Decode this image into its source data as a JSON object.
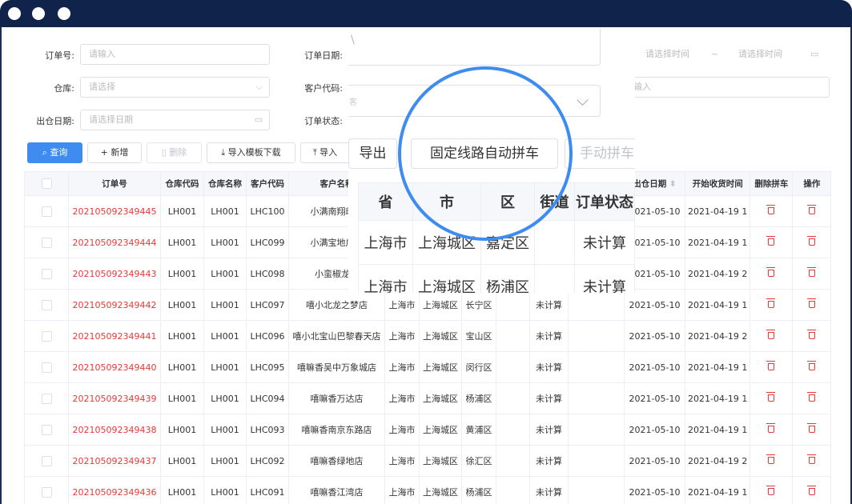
{
  "form": {
    "order_no_label": "订单号:",
    "order_no_placeholder": "请输入",
    "order_date_label": "订单日期:",
    "date_start_placeholder": "请选择时间",
    "date_sep": "~",
    "date_end_placeholder": "请选择时间",
    "warehouse_label": "仓库:",
    "warehouse_placeholder": "请选择",
    "customer_code_label": "客户代码:",
    "customer_code_placeholder": "输入",
    "out_date_label": "出仓日期:",
    "out_date_placeholder": "请选择日期",
    "order_status_label": "订单状态:"
  },
  "toolbar": {
    "query": "查询",
    "add": "新增",
    "delete": "删除",
    "import_template": "导入模板下载",
    "import": "导入"
  },
  "table": {
    "headers": [
      "订单号",
      "仓库代码",
      "仓库名称",
      "客户代码",
      "客户名称",
      "",
      "",
      "",
      "",
      "",
      "",
      "出仓日期",
      "开始收货时间",
      "删除拼车",
      "操作"
    ],
    "rows": [
      {
        "order": "202105092349445",
        "wh_code": "LH001",
        "wh_name": "LH001",
        "cust_code": "LHC100",
        "cust_name": "小满南翔印象",
        "prov": "",
        "city": "",
        "dist": "",
        "street": "",
        "status": "",
        "blank": "",
        "out_date": "2021-05-10",
        "recv": "2021-04-19 1"
      },
      {
        "order": "202105092349444",
        "wh_code": "LH001",
        "wh_name": "LH001",
        "cust_code": "LHC099",
        "cust_name": "小满宝地广场",
        "prov": "",
        "city": "",
        "dist": "",
        "street": "",
        "status": "",
        "blank": "",
        "out_date": "2021-05-10",
        "recv": "2021-04-19 1"
      },
      {
        "order": "202105092349443",
        "wh_code": "LH001",
        "wh_name": "LH001",
        "cust_code": "LHC098",
        "cust_name": "小蛮椒龙华",
        "prov": "",
        "city": "",
        "dist": "",
        "street": "",
        "status": "",
        "blank": "",
        "out_date": "2021-05-10",
        "recv": "2021-04-19 2"
      },
      {
        "order": "202105092349442",
        "wh_code": "LH001",
        "wh_name": "LH001",
        "cust_code": "LHC097",
        "cust_name": "嘻小北龙之梦店",
        "prov": "上海市",
        "city": "上海城区",
        "dist": "长宁区",
        "street": "",
        "status": "未计算",
        "blank": "",
        "out_date": "2021-05-10",
        "recv": "2021-04-19 1"
      },
      {
        "order": "202105092349441",
        "wh_code": "LH001",
        "wh_name": "LH001",
        "cust_code": "LHC096",
        "cust_name": "嘻小北宝山巴黎春天店",
        "prov": "上海市",
        "city": "上海城区",
        "dist": "宝山区",
        "street": "",
        "status": "未计算",
        "blank": "",
        "out_date": "2021-05-10",
        "recv": "2021-04-19 2"
      },
      {
        "order": "202105092349440",
        "wh_code": "LH001",
        "wh_name": "LH001",
        "cust_code": "LHC095",
        "cust_name": "嘻嘛香吴中万象城店",
        "prov": "上海市",
        "city": "上海城区",
        "dist": "闵行区",
        "street": "",
        "status": "未计算",
        "blank": "",
        "out_date": "2021-05-10",
        "recv": "2021-04-19 1"
      },
      {
        "order": "202105092349439",
        "wh_code": "LH001",
        "wh_name": "LH001",
        "cust_code": "LHC094",
        "cust_name": "嘻嘛香万达店",
        "prov": "上海市",
        "city": "上海城区",
        "dist": "杨浦区",
        "street": "",
        "status": "未计算",
        "blank": "",
        "out_date": "2021-05-10",
        "recv": "2021-04-19 1"
      },
      {
        "order": "202105092349438",
        "wh_code": "LH001",
        "wh_name": "LH001",
        "cust_code": "LHC093",
        "cust_name": "嘻嘛香南京东路店",
        "prov": "上海市",
        "city": "上海城区",
        "dist": "黄浦区",
        "street": "",
        "status": "未计算",
        "blank": "",
        "out_date": "2021-05-10",
        "recv": "2021-04-19 1"
      },
      {
        "order": "202105092349437",
        "wh_code": "LH001",
        "wh_name": "LH001",
        "cust_code": "LHC092",
        "cust_name": "嘻嘛香绿地店",
        "prov": "上海市",
        "city": "上海城区",
        "dist": "徐汇区",
        "street": "",
        "status": "未计算",
        "blank": "",
        "out_date": "2021-05-10",
        "recv": "2021-04-19 2"
      },
      {
        "order": "202105092349436",
        "wh_code": "LH001",
        "wh_name": "LH001",
        "cust_code": "LHC091",
        "cust_name": "嘻嘛香江湾店",
        "prov": "上海市",
        "city": "上海城区",
        "dist": "杨浦区",
        "street": "",
        "status": "未计算",
        "blank": "",
        "out_date": "2021-05-10",
        "recv": "2021-04-19 1"
      }
    ]
  },
  "zoom": {
    "customer_field_hint": "客",
    "export_label": "导出",
    "fixed_route_label": "固定线路自动拼车",
    "manual_label": "手动拼车",
    "headers": [
      "省",
      "市",
      "区",
      "街道",
      "订单状态"
    ],
    "row1": [
      "上海市",
      "上海城区",
      "嘉定区",
      "",
      "未计算"
    ],
    "row2": [
      "上海市",
      "上海城区",
      "杨浦区",
      "",
      "未计算"
    ]
  },
  "colors": {
    "accent": "#3e8cf0",
    "order_red": "#e53935",
    "titlebar": "#10234b"
  }
}
